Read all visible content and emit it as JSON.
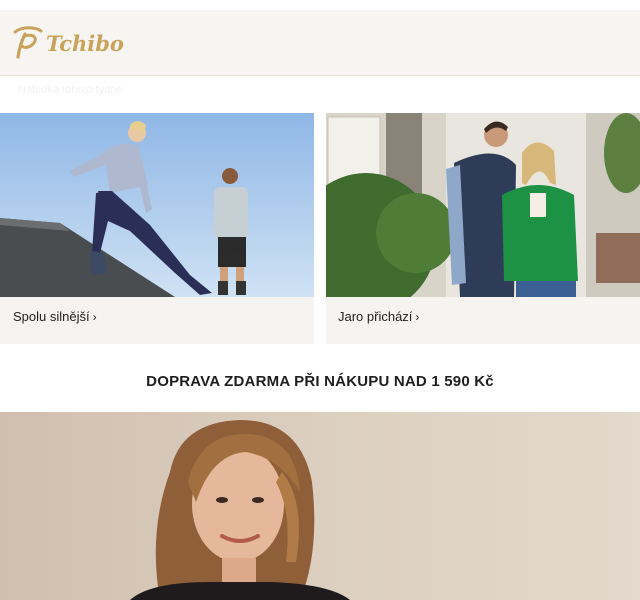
{
  "brand": {
    "name": "Tchibo",
    "color": "#c9a35b"
  },
  "header": {
    "subnav_text": "Nabídka tohoto týdne"
  },
  "tiles": [
    {
      "caption": "Spolu silnější",
      "chevron": "›",
      "image": "fitness-couple-photo"
    },
    {
      "caption": "Jaro přichází",
      "chevron": "›",
      "image": "spring-couple-photo"
    }
  ],
  "shipping_banner": {
    "text": "DOPRAVA ZDARMA PŘI NÁKUPU NAD 1 590 Kč"
  },
  "hero": {
    "image": "woman-portrait-photo"
  },
  "colors": {
    "header_bg": "#f7f5f1",
    "tile_bg": "#f6f4f1",
    "text": "#1e1e1e"
  }
}
